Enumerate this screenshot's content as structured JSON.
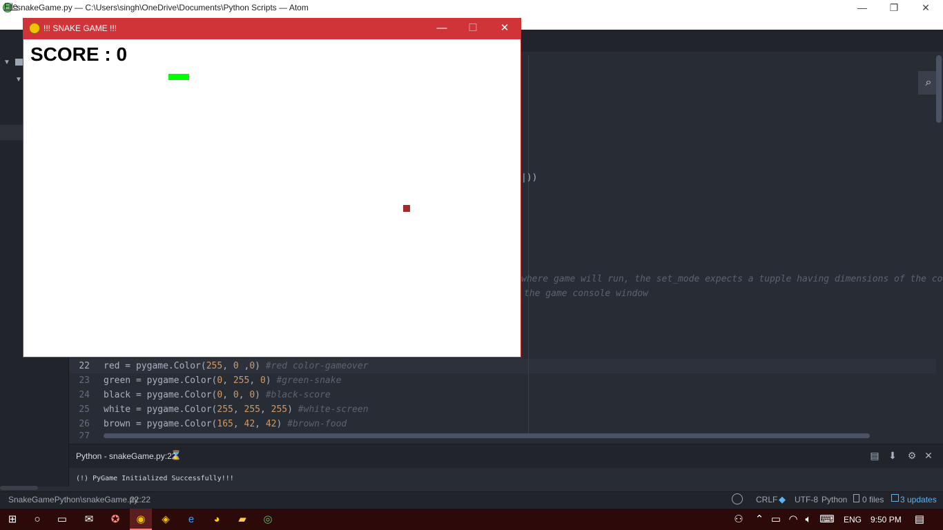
{
  "atom": {
    "title": "snakeGame.py — C:\\Users\\singh\\OneDrive\\Documents\\Python Scripts — Atom",
    "menu": [
      "File"
    ],
    "window_controls": [
      "—",
      "❐",
      "✕"
    ]
  },
  "editor": {
    "behind_window_text": {
      "paren_fragment": "|))",
      "comment_line1": "where game will run, the set_mode expects a tupple having dimensions of the cor",
      "comment_line2": "the game console window"
    },
    "lines": [
      {
        "num": "22",
        "var": "red",
        "call": " = pygame.Color(",
        "args": [
          {
            "t": "255",
            "k": "num"
          },
          {
            "t": ", ",
            "k": "plain"
          },
          {
            "t": "0",
            "k": "num"
          },
          {
            "t": " ,",
            "k": "plain"
          },
          {
            "t": "0",
            "k": "num"
          }
        ],
        "close": ") ",
        "comment": "#red color-gameover"
      },
      {
        "num": "23",
        "var": "green",
        "call": " = pygame.Color(",
        "args": [
          {
            "t": "0",
            "k": "num"
          },
          {
            "t": ", ",
            "k": "plain"
          },
          {
            "t": "255",
            "k": "num"
          },
          {
            "t": ", ",
            "k": "plain"
          },
          {
            "t": "0",
            "k": "num"
          }
        ],
        "close": ") ",
        "comment": "#green-snake"
      },
      {
        "num": "24",
        "var": "black",
        "call": " = pygame.Color(",
        "args": [
          {
            "t": "0",
            "k": "num"
          },
          {
            "t": ", ",
            "k": "plain"
          },
          {
            "t": "0",
            "k": "num"
          },
          {
            "t": ", ",
            "k": "plain"
          },
          {
            "t": "0",
            "k": "num"
          }
        ],
        "close": ") ",
        "comment": "#black-score"
      },
      {
        "num": "25",
        "var": "white",
        "call": " = pygame.Color(",
        "args": [
          {
            "t": "255",
            "k": "num"
          },
          {
            "t": ", ",
            "k": "plain"
          },
          {
            "t": "255",
            "k": "num"
          },
          {
            "t": ", ",
            "k": "plain"
          },
          {
            "t": "255",
            "k": "num"
          }
        ],
        "close": ") ",
        "comment": "#white-screen"
      },
      {
        "num": "26",
        "var": "brown",
        "call": " = pygame.Color(",
        "args": [
          {
            "t": "165",
            "k": "num"
          },
          {
            "t": ", ",
            "k": "plain"
          },
          {
            "t": "42",
            "k": "num"
          },
          {
            "t": ", ",
            "k": "plain"
          },
          {
            "t": "42",
            "k": "num"
          }
        ],
        "close": ") ",
        "comment": "#brown-food"
      }
    ],
    "partial_line_num": "27"
  },
  "panel": {
    "title": "Python - snakeGame.py:22",
    "output": "(!) PyGame Initialized Successfully!!!"
  },
  "status_bar": {
    "file_path": "SnakeGamePython\\snakeGame.py",
    "cursor": "22:22",
    "line_ending": "CRLF",
    "encoding": "UTF-8",
    "grammar": "Python",
    "files": "0 files",
    "updates": "3 updates"
  },
  "taskbar": {
    "language": "ENG",
    "time": "9:50 PM"
  },
  "game": {
    "title": "!!! SNAKE GAME !!!",
    "score_text": "SCORE : 0",
    "snake_color": "#00ff00",
    "food_color": "#a52a2a",
    "window_controls": [
      "—",
      "☐",
      "✕"
    ]
  },
  "colors": {
    "game_titlebar": "#d13438",
    "taskbar": "#2c0a0a",
    "updates_link": "#5bb4f5"
  }
}
